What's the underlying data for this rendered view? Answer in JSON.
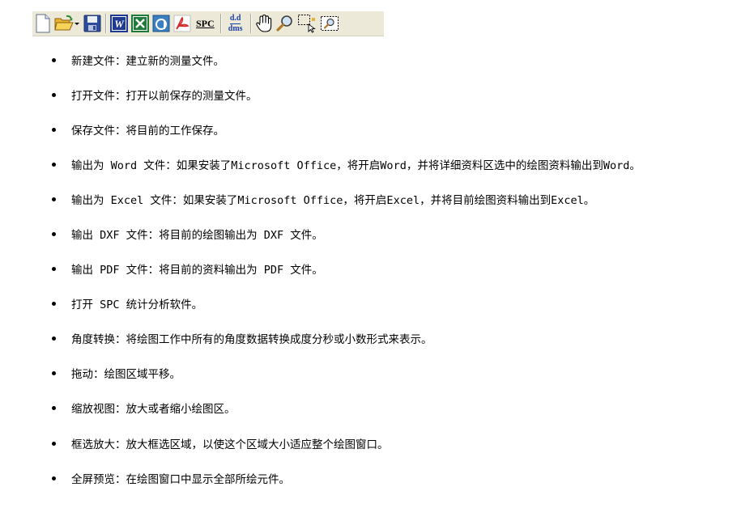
{
  "toolbar": {
    "spc_label": "SPC",
    "angle_top": "d.d",
    "angle_bottom": "dms",
    "buttons": [
      {
        "name": "new-file-icon"
      },
      {
        "name": "open-folder-icon"
      },
      {
        "name": "save-icon"
      },
      {
        "name": "word-icon",
        "color": "#1f3a93"
      },
      {
        "name": "excel-icon",
        "color": "#1e7b3a"
      },
      {
        "name": "dxf-icon",
        "color": "#3a7fc1"
      },
      {
        "name": "pdf-icon",
        "color": "#d42a2a"
      },
      {
        "name": "spc-icon"
      },
      {
        "name": "angle-convert-icon",
        "color": "#1a3fb0"
      },
      {
        "name": "hand-pan-icon"
      },
      {
        "name": "zoom-icon"
      },
      {
        "name": "box-zoom-icon"
      },
      {
        "name": "full-view-icon"
      }
    ]
  },
  "items": [
    {
      "name": "new-file",
      "text": "新建文件：建立新的测量文件。"
    },
    {
      "name": "open-file",
      "text": "打开文件：打开以前保存的测量文件。"
    },
    {
      "name": "save-file",
      "text": "保存文件：将目前的工作保存。"
    },
    {
      "name": "export-word",
      "text": "输出为 Word 文件：如果安装了Microsoft Office，将开启Word，并将详细资料区选中的绘图资料输出到Word。"
    },
    {
      "name": "export-excel",
      "text": "输出为 Excel 文件：如果安装了Microsoft Office，将开启Excel，并将目前绘图资料输出到Excel。"
    },
    {
      "name": "export-dxf",
      "text": "输出 DXF 文件：将目前的绘图输出为 DXF 文件。"
    },
    {
      "name": "export-pdf",
      "text": "输出 PDF 文件：将目前的资料输出为 PDF 文件。"
    },
    {
      "name": "open-spc",
      "text": "打开 SPC 统计分析软件。"
    },
    {
      "name": "angle-convert",
      "text": "角度转换：将绘图工作中所有的角度数据转换成度分秒或小数形式来表示。"
    },
    {
      "name": "pan",
      "text": "拖动：绘图区域平移。"
    },
    {
      "name": "zoom-view",
      "text": "缩放视图：放大或者缩小绘图区。"
    },
    {
      "name": "box-zoom",
      "text": "框选放大：放大框选区域，以使这个区域大小适应整个绘图窗口。"
    },
    {
      "name": "full-preview",
      "text": "全屏预览：在绘图窗口中显示全部所绘元件。"
    }
  ]
}
